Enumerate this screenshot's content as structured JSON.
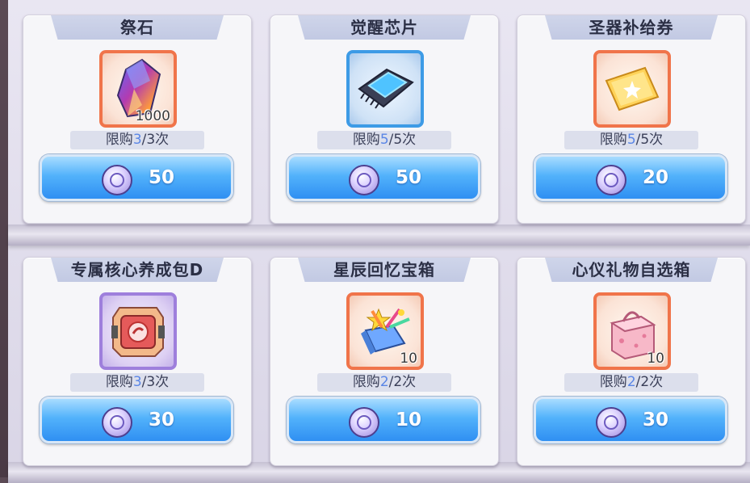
{
  "items": [
    {
      "name": "祭石",
      "limit_prefix": "限购",
      "limit_current": "3",
      "limit_suffix": "/3次",
      "count": "1000",
      "price": "50",
      "icon": "crystal-icon",
      "frame_color": "#f0744a"
    },
    {
      "name": "觉醒芯片",
      "limit_prefix": "限购",
      "limit_current": "5",
      "limit_suffix": "/5次",
      "count": "",
      "price": "50",
      "icon": "chip-icon",
      "frame_color": "#3d9be6"
    },
    {
      "name": "圣器补给券",
      "limit_prefix": "限购",
      "limit_current": "5",
      "limit_suffix": "/5次",
      "count": "",
      "price": "20",
      "icon": "ticket-icon",
      "frame_color": "#f0744a"
    },
    {
      "name": "专属核心养成包D",
      "limit_prefix": "限购",
      "limit_current": "3",
      "limit_suffix": "/3次",
      "count": "",
      "price": "30",
      "icon": "core-pack-icon",
      "frame_color": "#9e7fdc"
    },
    {
      "name": "星辰回忆宝箱",
      "limit_prefix": "限购",
      "limit_current": "2",
      "limit_suffix": "/2次",
      "count": "10",
      "price": "10",
      "icon": "gift-box-icon",
      "frame_color": "#f0744a"
    },
    {
      "name": "心仪礼物自选箱",
      "limit_prefix": "限购",
      "limit_current": "2",
      "limit_suffix": "/2次",
      "count": "10",
      "price": "30",
      "icon": "pink-box-icon",
      "frame_color": "#f0744a"
    }
  ],
  "currency_icon": "coin-icon"
}
